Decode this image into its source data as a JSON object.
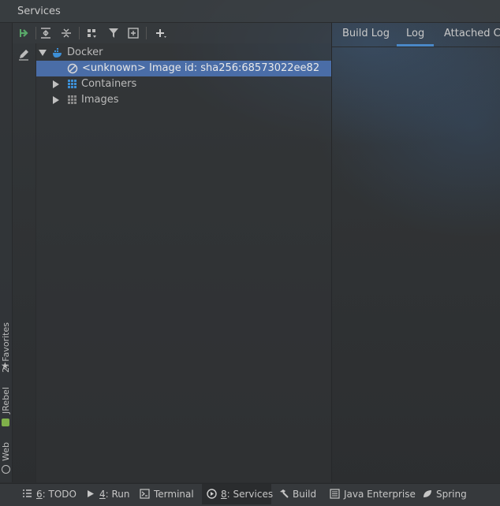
{
  "window": {
    "title": "Services"
  },
  "left_strip": {
    "tabs": [
      {
        "label": "2: Favorites",
        "icon": "star-icon"
      },
      {
        "label": "JRebel",
        "icon": "jrebel-icon"
      },
      {
        "label": "Web",
        "icon": "globe-icon"
      }
    ]
  },
  "toolbar": {
    "buttons": [
      {
        "name": "rerun-icon"
      },
      {
        "name": "expand-all-icon"
      },
      {
        "name": "collapse-all-icon"
      },
      {
        "name": "group-by-icon"
      },
      {
        "name": "filter-icon"
      },
      {
        "name": "new-tab-icon"
      },
      {
        "name": "add-icon"
      }
    ]
  },
  "side_tools": {
    "edit_icon": "pencil-icon"
  },
  "tree": {
    "items": [
      {
        "label": "Docker",
        "icon": "docker-icon",
        "expanded": true
      },
      {
        "label": "<unknown> Image id: sha256:68573022ee82",
        "icon": "unknown-icon",
        "selected": true
      },
      {
        "label": "Containers",
        "icon": "containers-icon",
        "expanded": false
      },
      {
        "label": "Images",
        "icon": "images-icon",
        "expanded": false
      }
    ]
  },
  "right_tabs": [
    {
      "label": "Build Log"
    },
    {
      "label": "Log",
      "active": true
    },
    {
      "label": "Attached Co"
    }
  ],
  "bottom_tabs": [
    {
      "label_prefix": "6",
      "label_rest": ": TODO",
      "icon": "list-icon"
    },
    {
      "label_prefix": "4",
      "label_rest": ": Run",
      "icon": "run-icon"
    },
    {
      "label_prefix": "",
      "label_rest": "Terminal",
      "icon": "terminal-icon"
    },
    {
      "label_prefix": "8",
      "label_rest": ": Services",
      "icon": "services-icon",
      "active": true
    },
    {
      "label_prefix": "",
      "label_rest": "Build",
      "icon": "hammer-icon"
    },
    {
      "label_prefix": "",
      "label_rest": "Java Enterprise",
      "icon": "java-enterprise-icon"
    },
    {
      "label_prefix": "",
      "label_rest": "Spring",
      "icon": "spring-icon"
    }
  ],
  "colors": {
    "selection": "#4a6da7",
    "active_tab_underline": "#4a88c7",
    "accent_green": "#59a869",
    "docker_blue": "#3d8fd6"
  }
}
